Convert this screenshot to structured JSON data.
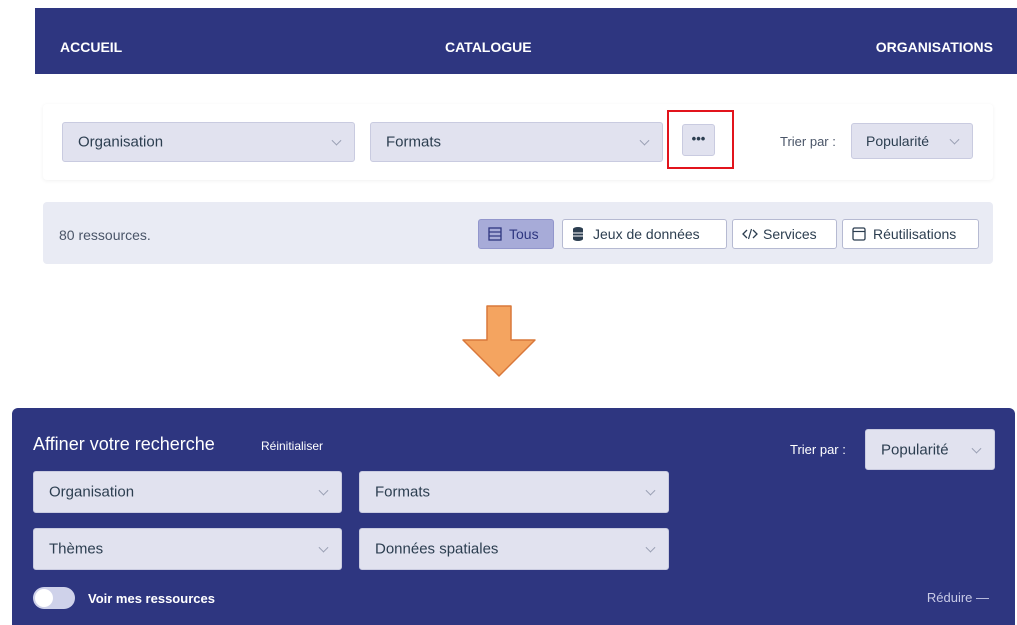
{
  "nav": {
    "accueil": "ACCUEIL",
    "catalogue": "CATALOGUE",
    "organisations": "ORGANISATIONS"
  },
  "filters": {
    "organisation": "Organisation",
    "formats": "Formats",
    "more_label": "•••",
    "sort_label": "Trier par :",
    "sort_value": "Popularité"
  },
  "results": {
    "count_text": "80 ressources.",
    "types": [
      {
        "label": "Tous",
        "icon": "list-icon",
        "selected": true
      },
      {
        "label": "Jeux de données",
        "icon": "database-icon",
        "selected": false
      },
      {
        "label": "Services",
        "icon": "code-icon",
        "selected": false
      },
      {
        "label": "Réutilisations",
        "icon": "window-icon",
        "selected": false
      }
    ]
  },
  "panel": {
    "title": "Affiner votre recherche",
    "reset": "Réinitialiser",
    "sort_label": "Trier par :",
    "sort_value": "Popularité",
    "organisation": "Organisation",
    "formats": "Formats",
    "themes": "Thèmes",
    "spatial": "Données spatiales",
    "toggle_label": "Voir mes ressources",
    "collapse": "Réduire —"
  },
  "colors": {
    "primary": "#2e3680",
    "select_bg": "#e1e2ef",
    "highlight": "#e2141c",
    "arrow": "#f4a460"
  }
}
